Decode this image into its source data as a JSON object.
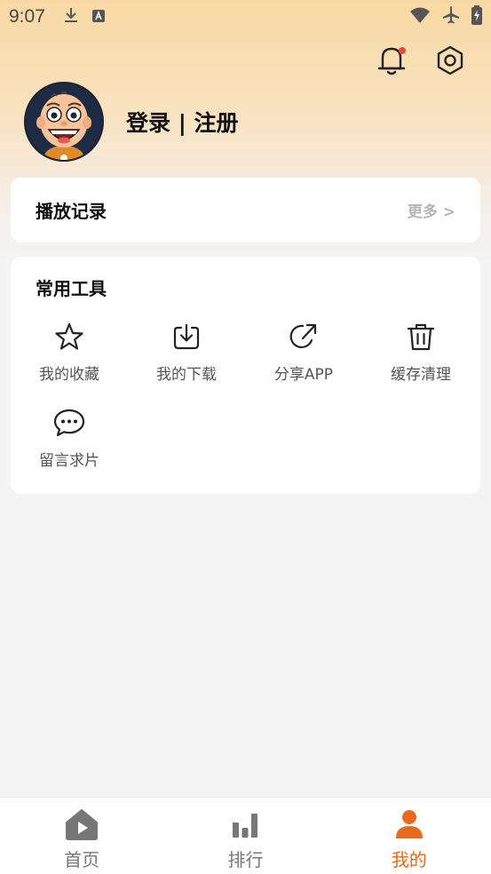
{
  "status_bar": {
    "time": "9:07"
  },
  "header": {
    "bell_has_notification": true,
    "accent_dot_color": "#f04a3c"
  },
  "profile": {
    "login_text": "登录 | 注册"
  },
  "history": {
    "title": "播放记录",
    "more_label": "更多 >"
  },
  "tools": {
    "title": "常用工具",
    "items": [
      {
        "label": "我的收藏",
        "icon": "star-icon"
      },
      {
        "label": "我的下载",
        "icon": "download-icon"
      },
      {
        "label": "分享APP",
        "icon": "share-icon"
      },
      {
        "label": "缓存清理",
        "icon": "trash-icon"
      },
      {
        "label": "留言求片",
        "icon": "message-icon"
      }
    ]
  },
  "tab_bar": {
    "tabs": [
      {
        "label": "首页",
        "icon": "home-icon",
        "active": false
      },
      {
        "label": "排行",
        "icon": "ranking-icon",
        "active": false
      },
      {
        "label": "我的",
        "icon": "profile-icon",
        "active": true
      }
    ],
    "active_color": "#e96a1c",
    "inactive_color": "#777777"
  }
}
